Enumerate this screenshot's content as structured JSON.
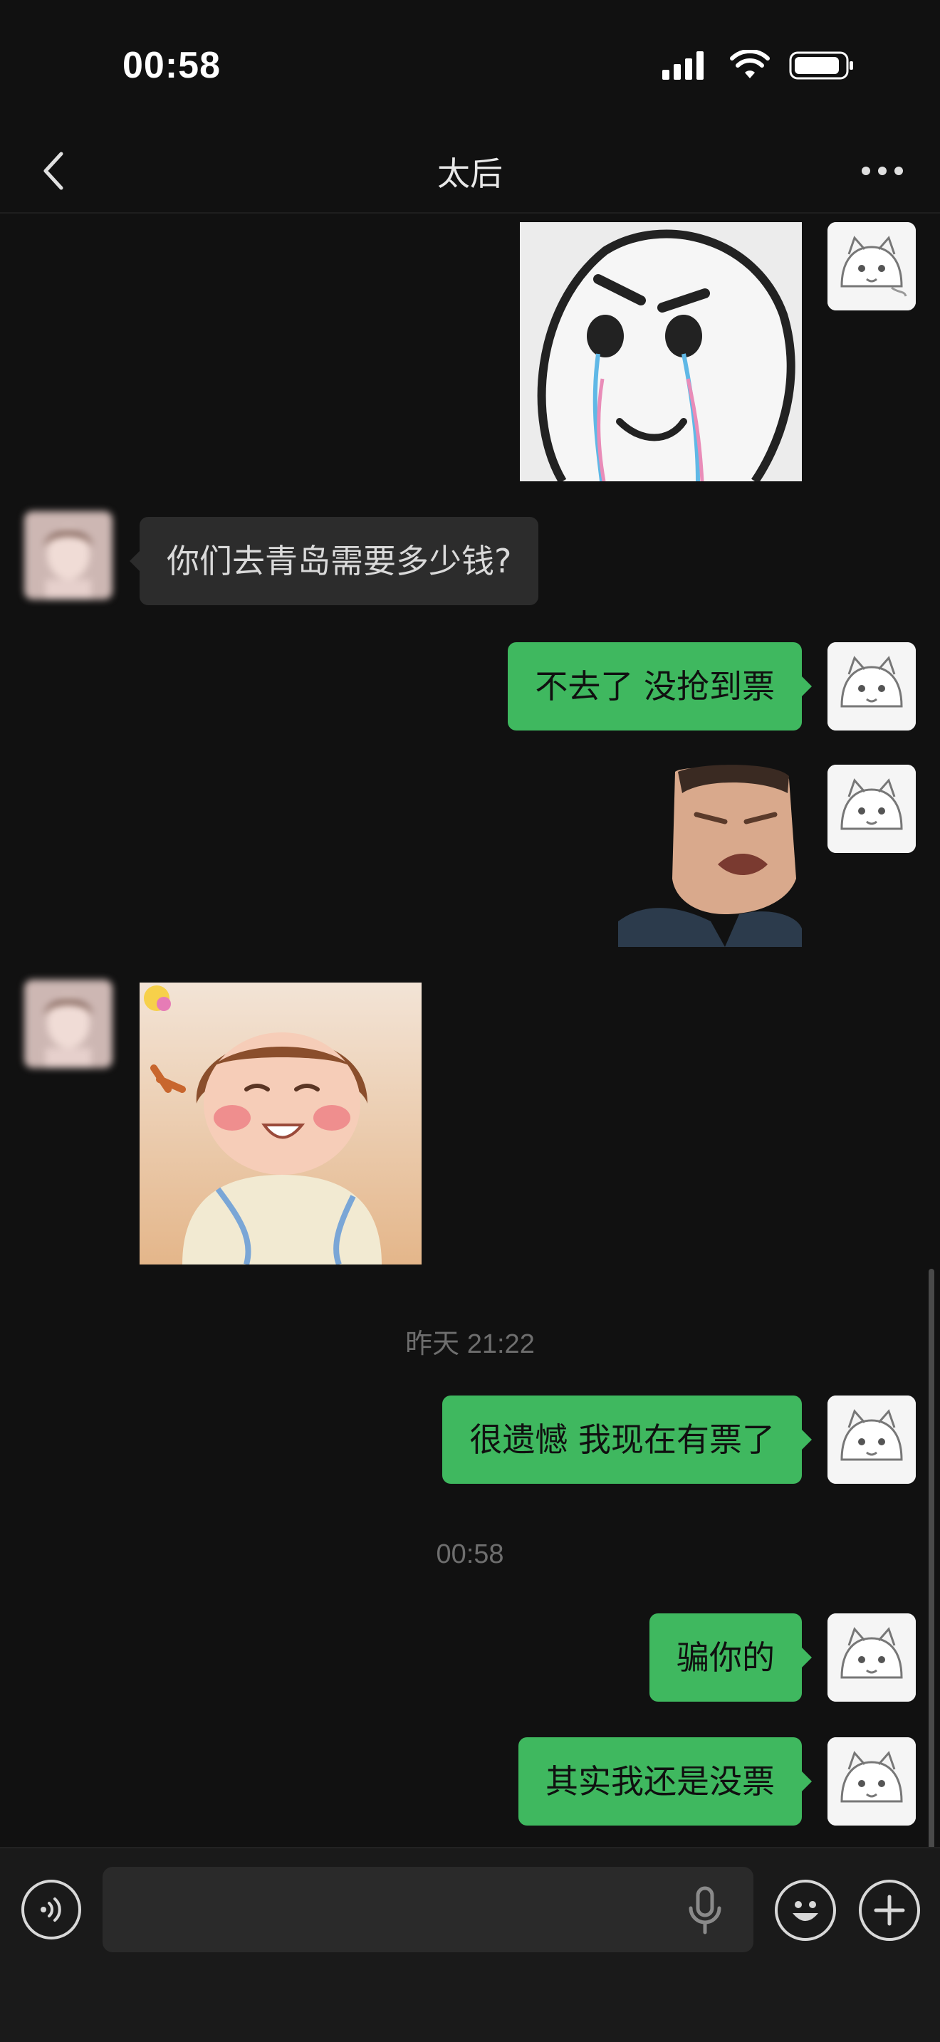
{
  "status_bar": {
    "time": "00:58",
    "icons": [
      "signal-icon",
      "wifi-icon",
      "battery-icon"
    ]
  },
  "header": {
    "title": "太后",
    "back_icon": "chevron-left-icon",
    "more_icon": "more-dots-icon"
  },
  "messages": [
    {
      "side": "out",
      "kind": "sticker",
      "sticker": "crying-round-face-sticker"
    },
    {
      "side": "in",
      "kind": "text",
      "text": "你们去青岛需要多少钱?"
    },
    {
      "side": "out",
      "kind": "text",
      "text": "不去了 没抢到票"
    },
    {
      "side": "out",
      "kind": "sticker",
      "sticker": "crying-man-sticker"
    },
    {
      "side": "in",
      "kind": "sticker",
      "sticker": "laughing-girl-sticker"
    },
    {
      "kind": "timestamp",
      "text": "昨天 21:22"
    },
    {
      "side": "out",
      "kind": "text",
      "text": "很遗憾 我现在有票了"
    },
    {
      "kind": "timestamp",
      "text": "00:58"
    },
    {
      "side": "out",
      "kind": "text",
      "text": "骗你的"
    },
    {
      "side": "out",
      "kind": "text",
      "text": "其实我还是没票"
    }
  ],
  "input_bar": {
    "placeholder": "",
    "icons": [
      "voice-icon",
      "microphone-icon",
      "emoji-icon",
      "plus-icon"
    ]
  },
  "colors": {
    "background": "#111111",
    "outgoing_bubble": "#3fb85f",
    "incoming_bubble": "#2c2c2c",
    "timestamp": "#6e6e6e"
  }
}
